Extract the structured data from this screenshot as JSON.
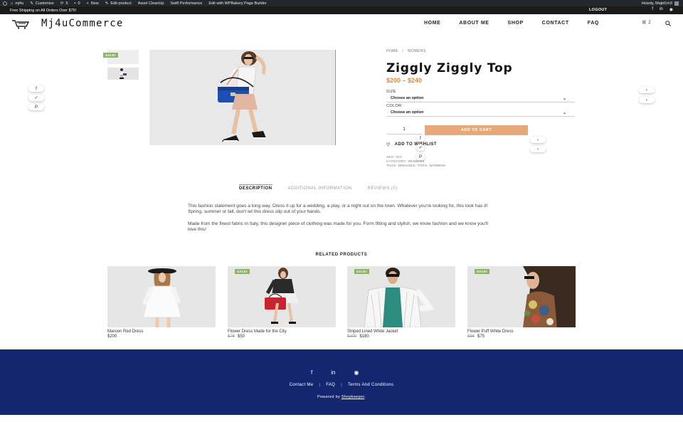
{
  "admin_bar": {
    "site": "mj4u",
    "customize": "Customize",
    "updates": "5",
    "comments": "0",
    "new": "New",
    "edit_product": "Edit product",
    "asset_cleanup": "Asset CleanUp",
    "swift": "Swift Performance",
    "wpbakery": "Edit with WPBakery Page Builder",
    "greeting": "Howdy, Majid1m3"
  },
  "top_strip": {
    "promo": "Free Shipping on All Orders Over $75!",
    "logout": "LOGOUT"
  },
  "header": {
    "logo": "Mj4uCommerce",
    "nav": [
      "HOME",
      "ABOUT ME",
      "SHOP",
      "CONTACT",
      "FAQ"
    ],
    "cart_count": "2"
  },
  "product": {
    "breadcrumb": [
      "HOME",
      "WOMENS"
    ],
    "breadcrumb_sep": "/",
    "title": "Ziggly Ziggly Top",
    "price": "$200 – $240",
    "sale_badge": "SALE!",
    "size_label": "SIZE",
    "size_value": "Choose an option",
    "color_label": "COLOR",
    "color_value": "Choose an option",
    "qty": "1",
    "add_to_cart": "ADD TO CART",
    "wishlist": "ADD TO WISHLIST",
    "sku": "SKU: N/A",
    "category": "CATEGORY: WOMENS",
    "tags": "TAGS: DRESSES, TOPS, WOMENS"
  },
  "tabs": [
    "DESCRIPTION",
    "ADDITIONAL INFORMATION",
    "REVIEWS (0)"
  ],
  "description": {
    "p1": "This fashion statement goes a long way. Dress it up for a wedding, a play, or a night out on the town. Whatever you're looking for, this look has it! Spring, summer or fall, don't let this dress slip out of your hands.",
    "p2": "Made from the finest fabric in Italy, this designer piece of clothing was made for you. Form fitting and stylish, we know fashion and we know you'll love this!"
  },
  "related": {
    "title": "RELATED PRODUCTS",
    "items": [
      {
        "name": "Maroon Red Dress",
        "old_price": "",
        "price": "$200",
        "sale": ""
      },
      {
        "name": "Flower Dress Made for the City",
        "old_price": "$76",
        "price": "$50",
        "sale": "SALE!"
      },
      {
        "name": "Striped Lined White Jacket",
        "old_price": "$200",
        "price": "$180",
        "sale": "SALE!"
      },
      {
        "name": "Flower Puff White Dress",
        "old_price": "$86",
        "price": "$75",
        "sale": "SALE!"
      }
    ]
  },
  "footer": {
    "links": [
      "Contact Me",
      "FAQ",
      "Terms And Conditions"
    ],
    "powered_prefix": "Powered by",
    "powered_link": "Shopkeeper",
    "powered_suffix": "."
  },
  "colors": {
    "accent": "#d98b32",
    "add_to_cart": "#e8a878",
    "sale": "#8bb36b",
    "footer": "#152670"
  }
}
